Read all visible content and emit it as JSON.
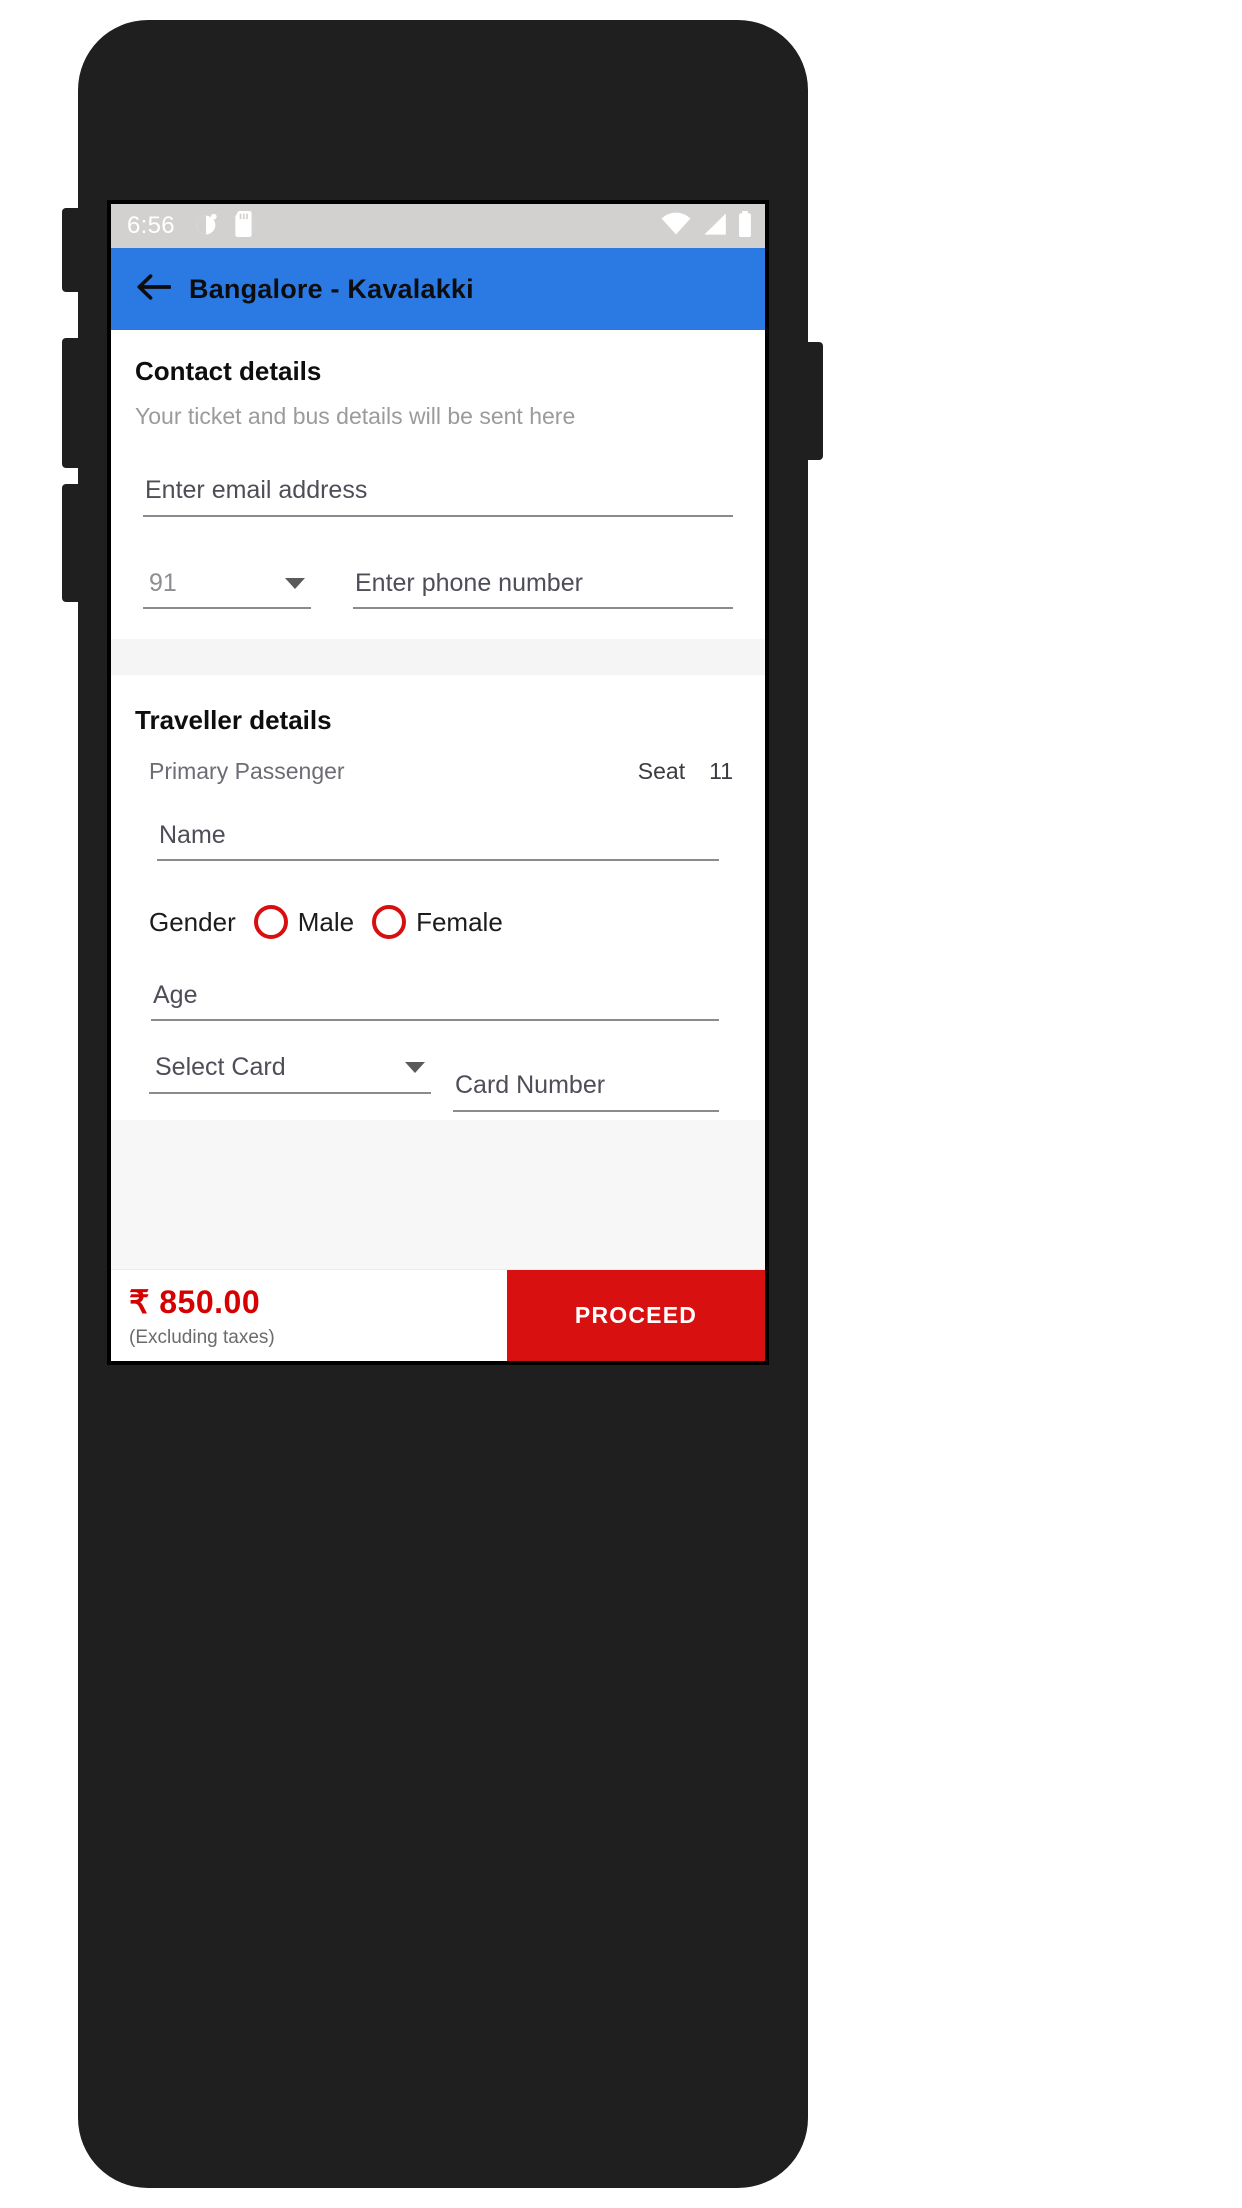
{
  "statusbar": {
    "time": "6:56",
    "left_icons": [
      "alarm-icon",
      "sd-card-icon"
    ],
    "right_icons": [
      "wifi-icon",
      "cellular-signal-icon",
      "battery-icon"
    ]
  },
  "appbar": {
    "back_icon": "back-arrow-icon",
    "title": "Bangalore - Kavalakki",
    "bg_color": "#2b7ae4"
  },
  "contact": {
    "title": "Contact details",
    "subtitle": "Your ticket and bus details will be sent here",
    "email": {
      "value": "",
      "placeholder": "Enter email address"
    },
    "country_code": {
      "value": "91",
      "caret_icon": "chevron-down-icon"
    },
    "phone": {
      "value": "",
      "placeholder": "Enter phone number"
    }
  },
  "traveller": {
    "title": "Traveller details",
    "passenger_label": "Primary Passenger",
    "seat_label": "Seat",
    "seat_number": "11",
    "name": {
      "value": "",
      "placeholder": "Name"
    },
    "gender": {
      "label": "Gender",
      "options": [
        "Male",
        "Female"
      ],
      "selected": "",
      "accent_color": "#d90f0f"
    },
    "age": {
      "value": "",
      "placeholder": "Age"
    },
    "card_type": {
      "value": "Select Card",
      "caret_icon": "chevron-down-icon"
    },
    "card_number": {
      "value": "",
      "placeholder": "Card Number"
    }
  },
  "pricebar": {
    "currency_symbol": "₹",
    "amount": "₹ 850.00",
    "note": "(Excluding taxes)",
    "proceed_label": "PROCEED",
    "price_color": "#d70000",
    "button_color": "#d8100f"
  },
  "navbar": {
    "back": "nav-back-icon",
    "home": "nav-home-icon",
    "recents": "nav-recents-icon"
  }
}
